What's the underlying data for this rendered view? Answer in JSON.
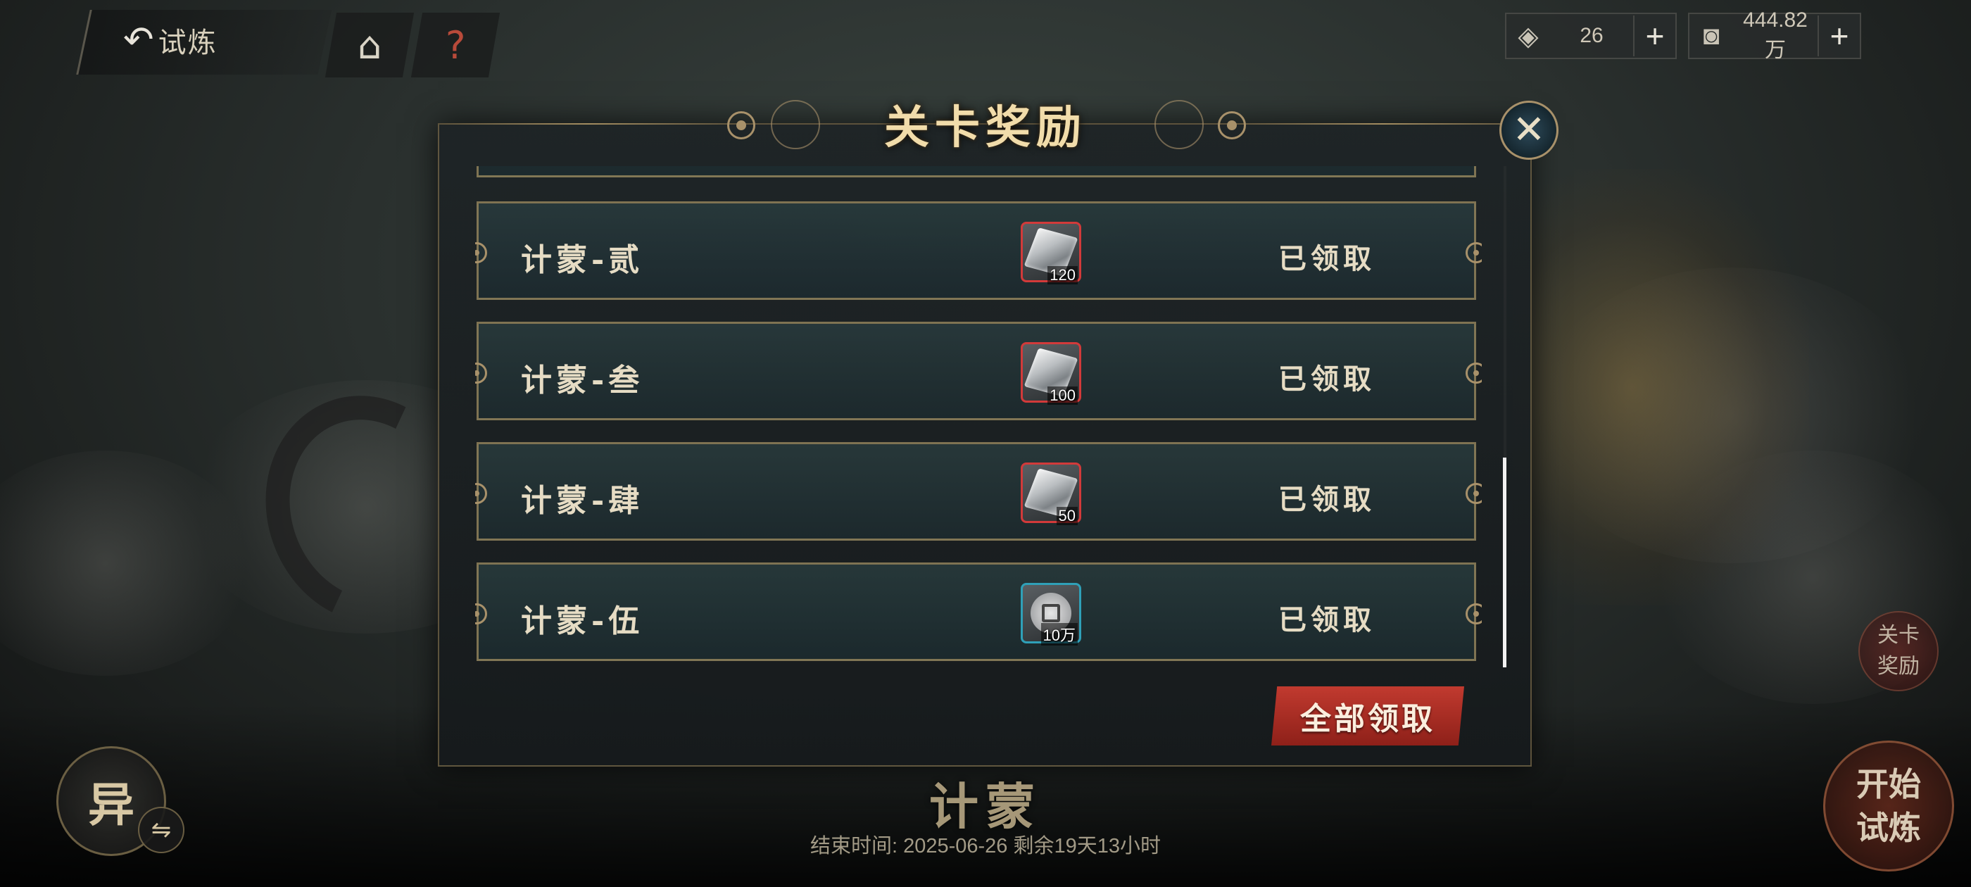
{
  "header": {
    "back_label": "试炼",
    "back_icon": "back-arrow-icon",
    "home_icon": "home-icon",
    "help_glyph": "?"
  },
  "resources": [
    {
      "icon": "ticket-icon",
      "value": "26",
      "plus": "+"
    },
    {
      "icon": "coin-icon",
      "value": "444.82万",
      "plus": "+"
    }
  ],
  "dialog": {
    "title": "关卡奖励",
    "close_glyph": "✕",
    "rows": [
      {
        "name": "计蒙-贰",
        "reward_type": "gem",
        "reward_border": "red",
        "reward_count": "120",
        "status": "已领取"
      },
      {
        "name": "计蒙-叁",
        "reward_type": "gem",
        "reward_border": "red",
        "reward_count": "100",
        "status": "已领取"
      },
      {
        "name": "计蒙-肆",
        "reward_type": "gem",
        "reward_border": "red",
        "reward_count": "50",
        "status": "已领取"
      },
      {
        "name": "计蒙-伍",
        "reward_type": "coin",
        "reward_border": "blue",
        "reward_count": "10万",
        "status": "已领取"
      }
    ],
    "claim_all_label": "全部领取"
  },
  "bottom": {
    "stage_title": "计蒙",
    "end_time": "结束时间: 2025-06-26   剩余19天13小时",
    "left_button_label": "异",
    "swap_glyph": "⇋",
    "side_reward_label_line1": "关卡",
    "side_reward_label_line2": "奖励",
    "start_label_line1": "开始",
    "start_label_line2": "试炼"
  },
  "colors": {
    "accent_gold": "#a8916a",
    "claim_red": "#c13a2f",
    "reward_red_border": "#d23a3a",
    "reward_blue_border": "#2fa0b8"
  }
}
